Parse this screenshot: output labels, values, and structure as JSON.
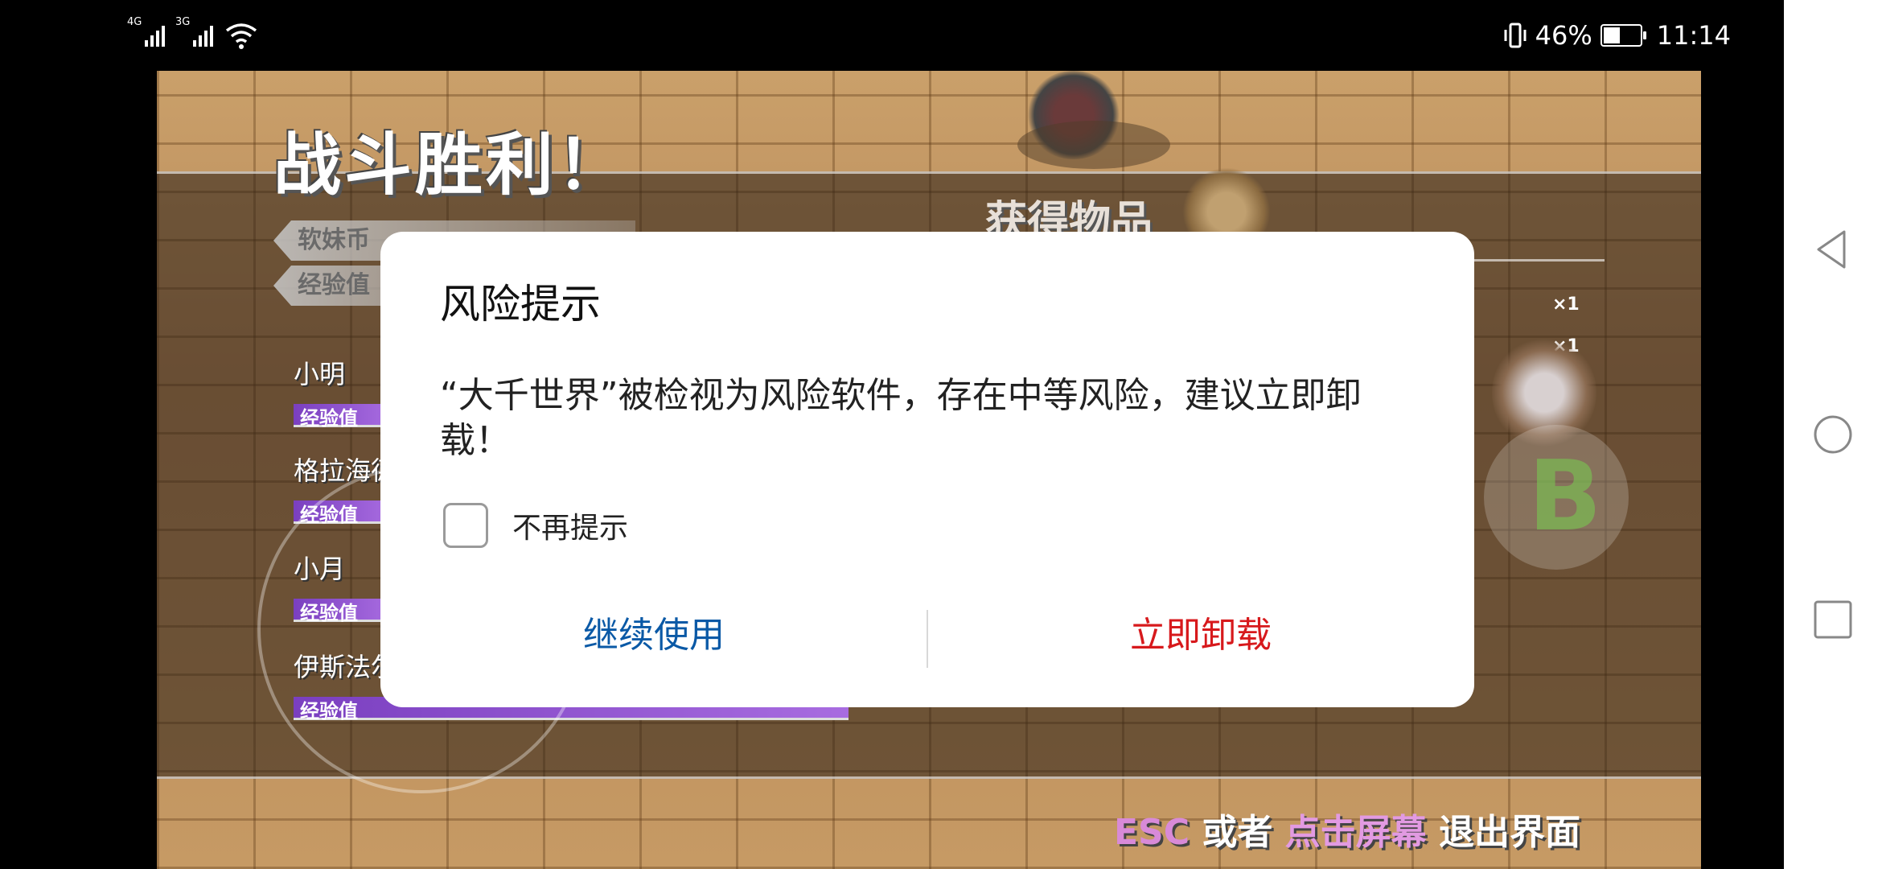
{
  "status_bar": {
    "network_1": "4G",
    "network_2": "3G",
    "battery_percent": "46%",
    "battery_level": 0.46,
    "time": "11:14"
  },
  "game": {
    "victory_title": "战斗胜利！",
    "items_title": "获得物品",
    "currency_label": "软妹币",
    "exp_label": "经验值",
    "members": [
      {
        "name": "小明",
        "exp_label": "经验值"
      },
      {
        "name": "格拉海德",
        "exp_label": "经验值"
      },
      {
        "name": "小月",
        "exp_label": "经验值"
      },
      {
        "name": "伊斯法尔",
        "exp_label": "经验值"
      }
    ],
    "item_counts": [
      "×1",
      "×1"
    ],
    "b_button": "B",
    "exit_hint": {
      "esc": "ESC",
      "or": " 或者 ",
      "tap": "点击屏幕",
      "rest": " 退出界面"
    }
  },
  "dialog": {
    "title": "风险提示",
    "message": "“大千世界”被检视为风险软件，存在中等风险，建议立即卸载！",
    "checkbox_label": "不再提示",
    "checkbox_checked": false,
    "continue_button": "继续使用",
    "uninstall_button": "立即卸载",
    "continue_color": "#0a59a6",
    "uninstall_color": "#d7191c"
  },
  "nav_bar": {
    "icons": [
      "back-icon",
      "home-icon",
      "recents-icon"
    ]
  }
}
